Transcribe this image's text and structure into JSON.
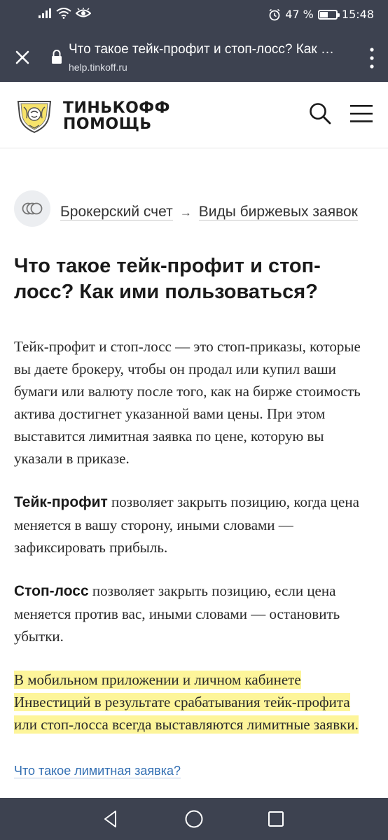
{
  "status_bar": {
    "battery_percent": "47 %",
    "battery_level": 0.47,
    "time": "15:48",
    "icons": [
      "signal-icon",
      "wifi-icon",
      "eye-icon",
      "alarm-icon",
      "battery-icon"
    ]
  },
  "browser": {
    "page_title": "Что такое тейк-профит и стоп-лосс? Как ими пользоваться?",
    "url": "help.tinkoff.ru",
    "icons": [
      "close-icon",
      "lock-icon",
      "more-vertical-icon"
    ]
  },
  "site_header": {
    "logo_line1": "ТИНЬКОФФ",
    "logo_line2": "ПОМОЩЬ",
    "icons": [
      "tinkoff-emblem-icon",
      "search-icon",
      "menu-icon"
    ]
  },
  "breadcrumb": {
    "item1": "Брокерский счет",
    "separator": "→",
    "item2": "Виды биржевых заявок",
    "icon": "coins-icon"
  },
  "article": {
    "title": "Что такое тейк-профит и стоп-лосс? Как ими пользоваться?",
    "p1": "Тейк-профит и стоп-лосс — это стоп-приказы, которые вы даете брокеру, чтобы он продал или купил ваши бумаги или валюту после того, как на бирже стоимость актива достигнет указанной вами цены. При этом выставится лимитная заявка по цене, которую вы указали в приказе.",
    "p2_term": "Тейк-профит",
    "p2_text": " позволяет закрыть позицию, когда цена меняется в вашу сторону, иными словами — зафиксировать прибыль.",
    "p3_term": "Стоп-лосс",
    "p3_text": " позволяет закрыть позицию, если цена меняется против вас, иными словами — остановить убытки.",
    "p4_highlight": "В мобильном приложении и личном кабинете Инвестиций в результате срабатывания тейк-профита или стоп-лосса всегда выставляются лимитные заявки.",
    "link_more": "Что такое лимитная заявка?"
  },
  "colors": {
    "bar_bg": "#3d4250",
    "highlight": "#fdf59a",
    "link": "#336fb3"
  },
  "nav_bar": {
    "icons": [
      "back-icon",
      "home-icon",
      "recents-icon"
    ]
  }
}
